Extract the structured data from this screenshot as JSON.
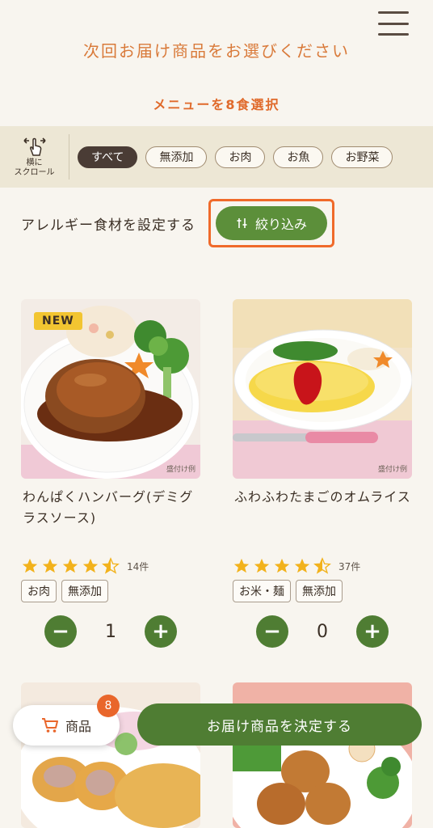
{
  "header": {
    "title": "次回お届け商品をお選びください",
    "subtitle": "メニューを8食選択"
  },
  "filter_bar": {
    "scroll_hint_line1": "横に",
    "scroll_hint_line2": "スクロール",
    "chips": [
      {
        "label": "すべて",
        "active": true
      },
      {
        "label": "無添加",
        "active": false
      },
      {
        "label": "お肉",
        "active": false
      },
      {
        "label": "お魚",
        "active": false
      },
      {
        "label": "お野菜",
        "active": false
      }
    ]
  },
  "allergy": {
    "text": "アレルギー食材を設定する",
    "filter_button": "絞り込み"
  },
  "products": [
    {
      "badge": "NEW",
      "name": "わんぱくハンバーグ(デミグラスソース)",
      "serving_note": "盛付け例",
      "rating": 4.5,
      "review_count": "14件",
      "tags": [
        "お肉",
        "無添加"
      ],
      "quantity": "1"
    },
    {
      "badge": "",
      "name": "ふわふわたまごのオムライス",
      "serving_note": "盛付け例",
      "rating": 4.5,
      "review_count": "37件",
      "tags": [
        "お米・麺",
        "無添加"
      ],
      "quantity": "0"
    }
  ],
  "footer": {
    "cart_label": "商品",
    "cart_count": "8",
    "confirm_label": "お届け商品を決定する"
  },
  "colors": {
    "accent_orange": "#e06a2b",
    "primary_green": "#4f7d33",
    "star_yellow": "#f2b21c"
  }
}
